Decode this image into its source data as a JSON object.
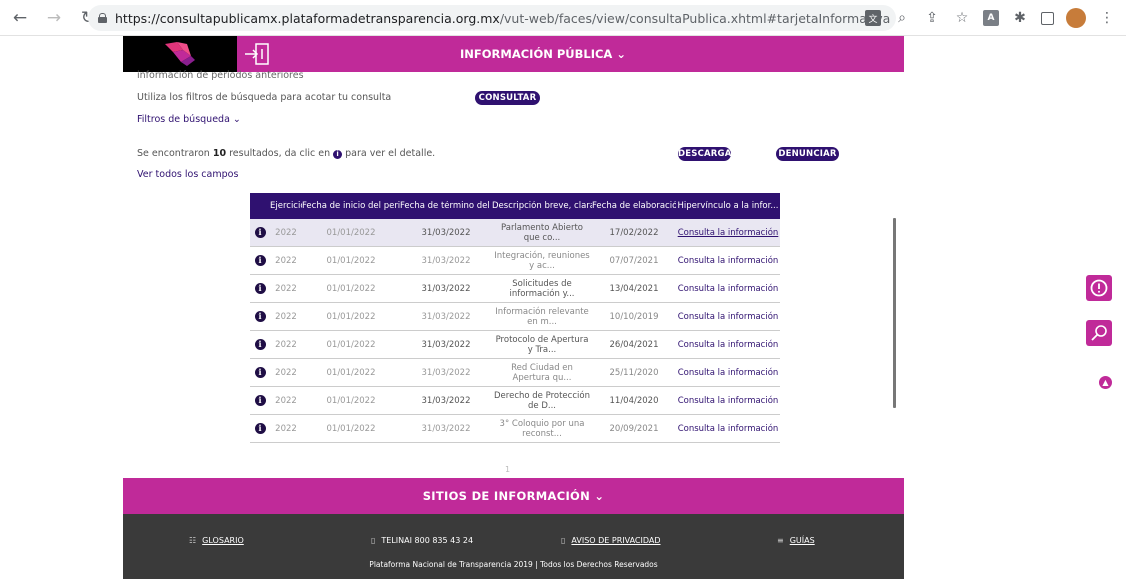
{
  "browser": {
    "url_host": "https://consultapublicamx.plataformadetransparencia.org.mx",
    "url_path": "/vut-web/faces/view/consultaPublica.xhtml#tarjetaInformativa"
  },
  "header": {
    "title": "INFORMACIÓN PÚBLICA ⌄"
  },
  "content": {
    "previous_periods": "información de periodos anteriores",
    "filters_hint": "Utiliza los filtros de búsqueda para acotar tu consulta",
    "consult_button": "CONSULTAR",
    "filters_toggle": "Filtros de búsqueda ⌄",
    "results_prefix": "Se encontraron ",
    "results_count": "10",
    "results_mid": " resultados, da clic en ",
    "results_suffix": " para ver el detalle.",
    "download_button": "DESCARGAR",
    "report_button": "DENUNCIAR",
    "all_fields": "Ver todos los campos"
  },
  "table": {
    "headers": [
      "Ejercicio",
      "Fecha de inicio del peri...",
      "Fecha de término del p...",
      "Descripción breve, clara...",
      "Fecha de elaboración",
      "Hipervínculo a la infor..."
    ],
    "rows": [
      {
        "year": "2022",
        "start": "01/01/2022",
        "end": "31/03/2022",
        "desc": "Parlamento Abierto que co...",
        "elab": "17/02/2022",
        "link": "Consulta la información"
      },
      {
        "year": "2022",
        "start": "01/01/2022",
        "end": "31/03/2022",
        "desc": "Integración, reuniones y ac...",
        "elab": "07/07/2021",
        "link": "Consulta la información"
      },
      {
        "year": "2022",
        "start": "01/01/2022",
        "end": "31/03/2022",
        "desc": "Solicitudes de información y...",
        "elab": "13/04/2021",
        "link": "Consulta la información"
      },
      {
        "year": "2022",
        "start": "01/01/2022",
        "end": "31/03/2022",
        "desc": "Información relevante en m...",
        "elab": "10/10/2019",
        "link": "Consulta la información"
      },
      {
        "year": "2022",
        "start": "01/01/2022",
        "end": "31/03/2022",
        "desc": "Protocolo de Apertura y Tra...",
        "elab": "26/04/2021",
        "link": "Consulta la información"
      },
      {
        "year": "2022",
        "start": "01/01/2022",
        "end": "31/03/2022",
        "desc": "Red Ciudad en Apertura qu...",
        "elab": "25/11/2020",
        "link": "Consulta la información"
      },
      {
        "year": "2022",
        "start": "01/01/2022",
        "end": "31/03/2022",
        "desc": "Derecho de Protección de D...",
        "elab": "11/04/2020",
        "link": "Consulta la información"
      },
      {
        "year": "2022",
        "start": "01/01/2022",
        "end": "31/03/2022",
        "desc": "3° Coloquio por una reconst...",
        "elab": "20/09/2021",
        "link": "Consulta la información"
      }
    ],
    "page": "1"
  },
  "footer": {
    "sites_title": "SITIOS DE INFORMACIÓN ⌄",
    "glossary": "GLOSARIO",
    "phone": "TELINAI 800 835 43 24",
    "privacy": "AVISO DE PRIVACIDAD",
    "guides": "GUÍAS",
    "copyright": "Plataforma Nacional de Transparencia 2019 | Todos los Derechos Reservados"
  },
  "colors": {
    "magenta": "#c02a99",
    "purple": "#2f1170",
    "footer_dark": "#3a3a3a"
  }
}
